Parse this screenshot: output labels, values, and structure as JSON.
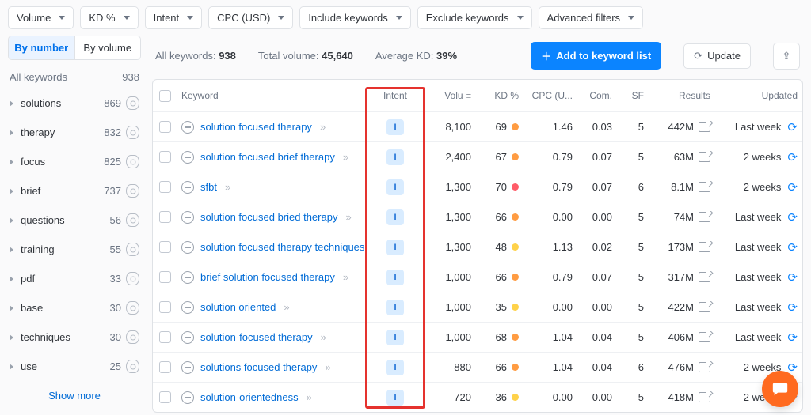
{
  "filters": [
    {
      "label": "Volume"
    },
    {
      "label": "KD %"
    },
    {
      "label": "Intent"
    },
    {
      "label": "CPC (USD)"
    },
    {
      "label": "Include keywords"
    },
    {
      "label": "Exclude keywords"
    },
    {
      "label": "Advanced filters"
    }
  ],
  "sidebar": {
    "seg_by_number": "By number",
    "seg_by_volume": "By volume",
    "all_label": "All keywords",
    "all_count": "938",
    "items": [
      {
        "label": "solutions",
        "count": "869"
      },
      {
        "label": "therapy",
        "count": "832"
      },
      {
        "label": "focus",
        "count": "825"
      },
      {
        "label": "brief",
        "count": "737"
      },
      {
        "label": "questions",
        "count": "56"
      },
      {
        "label": "training",
        "count": "55"
      },
      {
        "label": "pdf",
        "count": "33"
      },
      {
        "label": "base",
        "count": "30"
      },
      {
        "label": "techniques",
        "count": "30"
      },
      {
        "label": "use",
        "count": "25"
      }
    ],
    "show_more": "Show more"
  },
  "summary": {
    "all_label": "All keywords:",
    "all_value": "938",
    "vol_label": "Total volume:",
    "vol_value": "45,640",
    "kd_label": "Average KD:",
    "kd_value": "39%",
    "add_btn": "Add to keyword list",
    "update_btn": "Update"
  },
  "columns": {
    "keyword": "Keyword",
    "intent": "Intent",
    "volume": "Volu",
    "kd": "KD %",
    "cpc": "CPC (U...",
    "com": "Com.",
    "sf": "SF",
    "results": "Results",
    "updated": "Updated"
  },
  "intent_letter": "I",
  "rows": [
    {
      "kw": "solution focused therapy",
      "vol": "8,100",
      "kd": "69",
      "kdc": "var(--orange)",
      "cpc": "1.46",
      "com": "0.03",
      "sf": "5",
      "res": "442M",
      "upd": "Last week"
    },
    {
      "kw": "solution focused brief therapy",
      "vol": "2,400",
      "kd": "67",
      "kdc": "var(--orange)",
      "cpc": "0.79",
      "com": "0.07",
      "sf": "5",
      "res": "63M",
      "upd": "2 weeks"
    },
    {
      "kw": "sfbt",
      "vol": "1,300",
      "kd": "70",
      "kdc": "var(--red)",
      "cpc": "0.79",
      "com": "0.07",
      "sf": "6",
      "res": "8.1M",
      "upd": "2 weeks"
    },
    {
      "kw": "solution focused bried therapy",
      "vol": "1,300",
      "kd": "66",
      "kdc": "var(--orange)",
      "cpc": "0.00",
      "com": "0.00",
      "sf": "5",
      "res": "74M",
      "upd": "Last week"
    },
    {
      "kw": "solution focused therapy techniques",
      "vol": "1,300",
      "kd": "48",
      "kdc": "var(--yellow)",
      "cpc": "1.13",
      "com": "0.02",
      "sf": "5",
      "res": "173M",
      "upd": "Last week"
    },
    {
      "kw": "brief solution focused therapy",
      "vol": "1,000",
      "kd": "66",
      "kdc": "var(--orange)",
      "cpc": "0.79",
      "com": "0.07",
      "sf": "5",
      "res": "317M",
      "upd": "Last week"
    },
    {
      "kw": "solution oriented",
      "vol": "1,000",
      "kd": "35",
      "kdc": "var(--yellow)",
      "cpc": "0.00",
      "com": "0.00",
      "sf": "5",
      "res": "422M",
      "upd": "Last week"
    },
    {
      "kw": "solution-focused therapy",
      "vol": "1,000",
      "kd": "68",
      "kdc": "var(--orange)",
      "cpc": "1.04",
      "com": "0.04",
      "sf": "5",
      "res": "406M",
      "upd": "Last week"
    },
    {
      "kw": "solutions focused therapy",
      "vol": "880",
      "kd": "66",
      "kdc": "var(--orange)",
      "cpc": "1.04",
      "com": "0.04",
      "sf": "6",
      "res": "476M",
      "upd": "2 weeks"
    },
    {
      "kw": "solution-orientedness",
      "vol": "720",
      "kd": "36",
      "kdc": "var(--yellow)",
      "cpc": "0.00",
      "com": "0.00",
      "sf": "5",
      "res": "418M",
      "upd": "2 weeks"
    }
  ]
}
